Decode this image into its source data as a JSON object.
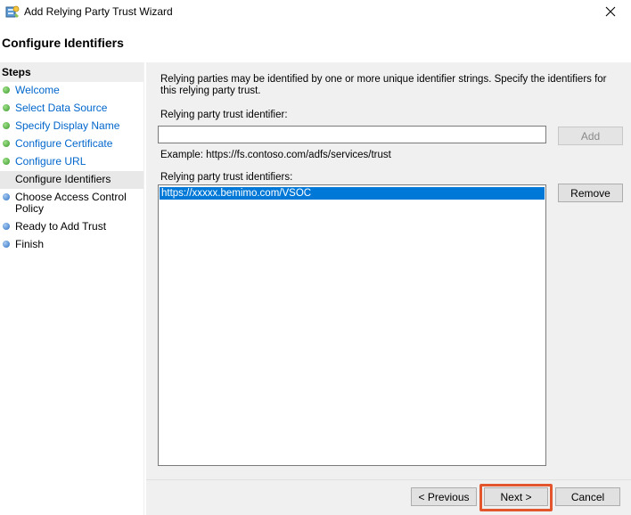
{
  "window": {
    "title": "Add Relying Party Trust Wizard"
  },
  "page": {
    "heading": "Configure Identifiers"
  },
  "steps": {
    "header": "Steps",
    "items": [
      {
        "label": "Welcome",
        "status": "done"
      },
      {
        "label": "Select Data Source",
        "status": "done"
      },
      {
        "label": "Specify Display Name",
        "status": "done"
      },
      {
        "label": "Configure Certificate",
        "status": "done"
      },
      {
        "label": "Configure URL",
        "status": "done"
      },
      {
        "label": "Configure Identifiers",
        "status": "current"
      },
      {
        "label": "Choose Access Control Policy",
        "status": "pending"
      },
      {
        "label": "Ready to Add Trust",
        "status": "pending"
      },
      {
        "label": "Finish",
        "status": "pending"
      }
    ]
  },
  "main": {
    "intro": "Relying parties may be identified by one or more unique identifier strings. Specify the identifiers for this relying party trust.",
    "identifier_label": "Relying party trust identifier:",
    "identifier_value": "",
    "add_label": "Add",
    "example": "Example: https://fs.contoso.com/adfs/services/trust",
    "identifiers_label": "Relying party trust identifiers:",
    "identifiers": [
      "https://xxxxx.bemimo.com/VSOC"
    ],
    "remove_label": "Remove"
  },
  "footer": {
    "previous_label": "< Previous",
    "next_label": "Next >",
    "cancel_label": "Cancel"
  },
  "colors": {
    "highlight": "#e2552d",
    "selection": "#0078d7",
    "link": "#0066cc"
  }
}
